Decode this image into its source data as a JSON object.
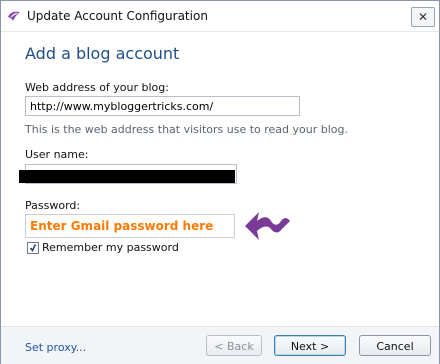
{
  "window": {
    "title": "Update Account Configuration",
    "close_label": "✕"
  },
  "page": {
    "heading": "Add a blog account"
  },
  "form": {
    "web_address_label": "Web address of your blog:",
    "web_address_value": "http://www.mybloggertricks.com/",
    "web_address_hint": "This is the web address that visitors use to read your blog.",
    "username_label": "User name:",
    "password_label": "Password:",
    "password_overlay": "Enter Gmail  password here",
    "remember_label": "Remember my password",
    "remember_checked": true
  },
  "footer": {
    "proxy_link": "Set proxy...",
    "back_label": "< Back",
    "next_label": "Next >",
    "cancel_label": "Cancel"
  },
  "colors": {
    "heading": "#1f4f86",
    "overlay_text": "#ff7a00",
    "arrow": "#7b3a98",
    "link": "#1f56a8"
  },
  "icons": {
    "app": "live-writer-icon",
    "close": "close-icon",
    "checkbox": "checkmark-icon",
    "arrow": "purple-squiggle-arrow-icon"
  }
}
